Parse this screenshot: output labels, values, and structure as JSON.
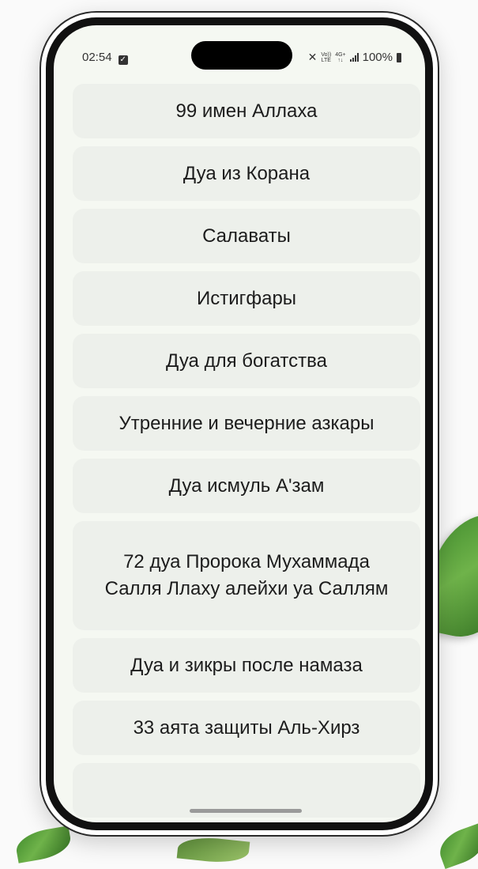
{
  "status_bar": {
    "time": "02:54",
    "check_glyph": "✓",
    "mute_icon": "✕",
    "volte_top": "Vo))",
    "volte_bottom": "LTE",
    "net_top": "4G+",
    "net_bottom": "↑↓",
    "battery_text": "100%"
  },
  "menu": {
    "items": [
      {
        "label": "99 имен Аллаха"
      },
      {
        "label": "Дуа из Корана"
      },
      {
        "label": "Салаваты"
      },
      {
        "label": "Истигфары"
      },
      {
        "label": "Дуа для богатства"
      },
      {
        "label": "Утренние и вечерние азкары"
      },
      {
        "label": "Дуа исмуль А'зам"
      },
      {
        "label": "72 дуа Пророка Мухаммада Салля Ллаху алейхи уа Саллям"
      },
      {
        "label": "Дуа и зикры после намаза"
      },
      {
        "label": "33 аята защиты Аль-Хирз"
      }
    ]
  },
  "colors": {
    "screen_bg": "#f5f8f2",
    "item_bg": "#edf0eb",
    "text": "#1c1c1c"
  }
}
